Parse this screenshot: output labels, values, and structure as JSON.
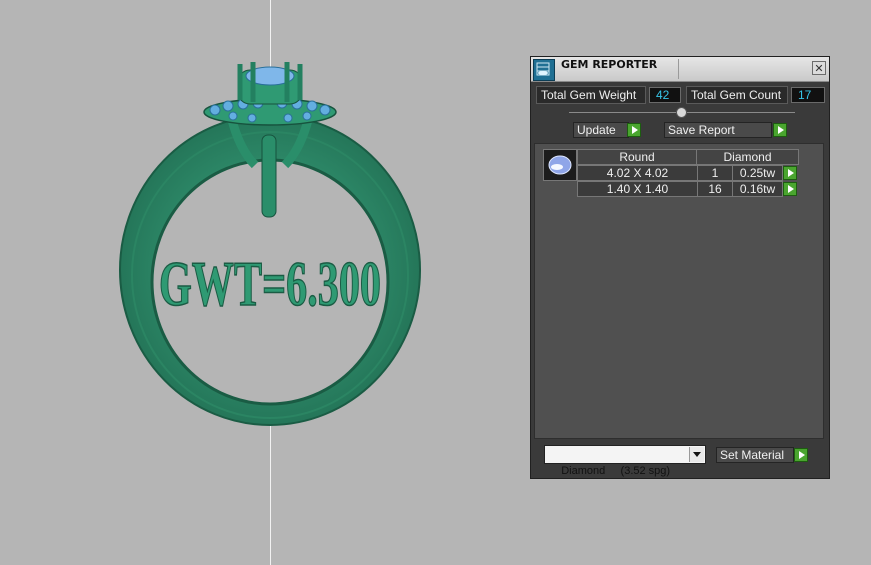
{
  "viewport": {
    "engraving_text": "GWT=6.300",
    "ring_color": "#2e8a6a",
    "gem_color": "#5fa6d6"
  },
  "panel": {
    "title": "GEM REPORTER",
    "app_icon": "gem-reporter-icon",
    "close_icon": "close-icon",
    "total_gem_weight_label": "Total Gem Weight",
    "total_gem_weight_value": "42",
    "total_gem_count_label": "Total Gem Count",
    "total_gem_count_value": "17",
    "update_label": "Update",
    "save_report_label": "Save Report",
    "accent_color": "#4aa52f",
    "value_color": "#37c6e8"
  },
  "gem_table": {
    "shape_header": "Round",
    "material_header": "Diamond",
    "rows": [
      {
        "size": "4.02 X 4.02",
        "count": "1",
        "weight": "0.25tw"
      },
      {
        "size": "1.40 X 1.40",
        "count": "16",
        "weight": "0.16tw"
      }
    ]
  },
  "material": {
    "selected": "Diamond     (3.52 spg)",
    "set_material_label": "Set Material"
  }
}
